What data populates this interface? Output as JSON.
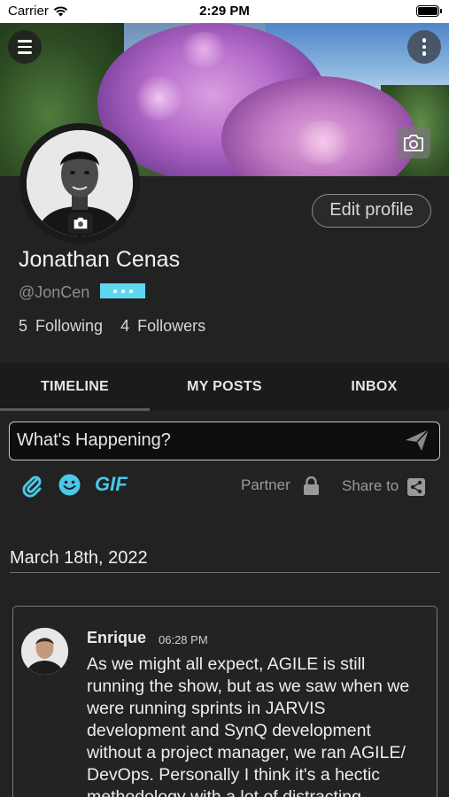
{
  "status_bar": {
    "carrier": "Carrier",
    "time": "2:29 PM"
  },
  "profile": {
    "edit_label": "Edit profile",
    "name": "Jonathan Cenas",
    "handle": "@JonCen",
    "following_count": "5",
    "following_label": "Following",
    "followers_count": "4",
    "followers_label": "Followers"
  },
  "tabs": [
    {
      "label": "TIMELINE"
    },
    {
      "label": "MY POSTS"
    },
    {
      "label": "INBOX"
    }
  ],
  "composer": {
    "placeholder": "What's Happening?",
    "gif_label": "GIF",
    "partner_label": "Partner",
    "share_label": "Share to"
  },
  "feed": {
    "date": "March 18th, 2022",
    "post": {
      "author": "Enrique",
      "time": "06:28 PM",
      "body": "As we might all expect, AGILE is still running the show, but as we saw when we were running sprints in JARVIS development and SynQ development without a project manager, we ran AGILE/ DevOps. Personally I think it's a hectic methodology with a lot of distracting"
    }
  },
  "colors": {
    "accent": "#4ac8e8",
    "background": "#222222",
    "tab_bar": "#1b1b1b"
  }
}
